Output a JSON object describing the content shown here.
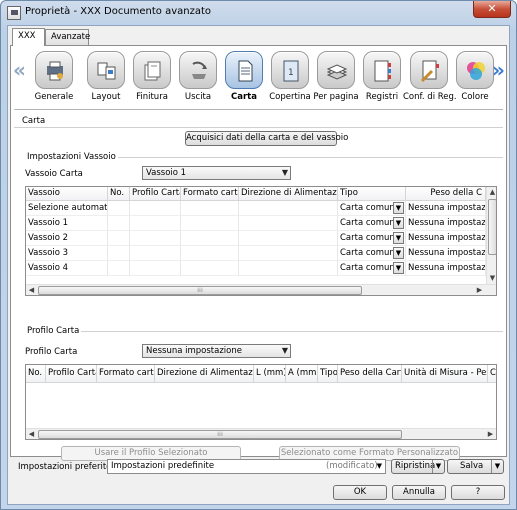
{
  "window": {
    "title": "Proprietà - XXX Documento avanzato",
    "close_label": "✕"
  },
  "tabs": [
    {
      "label": "XXX"
    },
    {
      "label": "Avanzate"
    }
  ],
  "nav": {
    "left_arrow": "«",
    "right_arrow": "»",
    "items": [
      {
        "label": "Generale",
        "icon": "printer-gear-icon"
      },
      {
        "label": "Layout",
        "icon": "layout-pages-icon"
      },
      {
        "label": "Finitura",
        "icon": "finishing-stack-icon"
      },
      {
        "label": "Uscita",
        "icon": "output-tray-icon"
      },
      {
        "label": "Carta",
        "icon": "paper-sheet-icon",
        "active": true
      },
      {
        "label": "Copertina",
        "icon": "cover-page-icon"
      },
      {
        "label": "Per pagina",
        "icon": "per-page-stack-icon"
      },
      {
        "label": "Registri",
        "icon": "tab-dividers-icon"
      },
      {
        "label": "Conf. di Reg.",
        "icon": "register-settings-icon"
      },
      {
        "label": "Colore",
        "icon": "color-circles-icon"
      }
    ]
  },
  "carta": {
    "section_title": "Carta",
    "acquire_button": "Acquisici dati della carta e del vassoio",
    "tray_settings_title": "Impostazioni Vassoio",
    "tray_label": "Vassoio Carta",
    "tray_value": "Vassoio 1",
    "tray_table": {
      "columns": [
        "Vassoio",
        "No.",
        "Profilo Carta",
        "Formato carta",
        "Direzione di Alimentazione",
        "Tipo",
        "Peso della C"
      ],
      "rows": [
        {
          "vassoio": "Selezione automatica",
          "tipo": "Carta comune",
          "peso": "Nessuna impostazione"
        },
        {
          "vassoio": "Vassoio 1",
          "tipo": "Carta comune",
          "peso": "Nessuna impostazione"
        },
        {
          "vassoio": "Vassoio 2",
          "tipo": "Carta comune",
          "peso": "Nessuna impostazione"
        },
        {
          "vassoio": "Vassoio 3",
          "tipo": "Carta comune",
          "peso": "Nessuna impostazione"
        },
        {
          "vassoio": "Vassoio 4",
          "tipo": "Carta comune",
          "peso": "Nessuna impostazione"
        }
      ]
    },
    "profile_title": "Profilo Carta",
    "profile_label": "Profilo Carta",
    "profile_value": "Nessuna impostazione",
    "profile_table": {
      "columns": [
        "No.",
        "Profilo Carta",
        "Formato carta",
        "Direzione di Alimentazione",
        "L (mm)",
        "A (mm)",
        "Tipo",
        "Peso della Carta",
        "Unità di Misura - Peso",
        "Co"
      ]
    },
    "use_profile_button": "Usare il Profilo Selezionato",
    "custom_format_button": "Selezionato come Formato Personalizzato"
  },
  "footer": {
    "preferences_label": "Impostazioni preferite",
    "preferences_value": "Impostazioni predefinite",
    "preferences_state": "(modificato)",
    "restore_button": "Ripristina",
    "save_button": "Salva",
    "ok_button": "OK",
    "cancel_button": "Annulla",
    "help_button": "?"
  }
}
